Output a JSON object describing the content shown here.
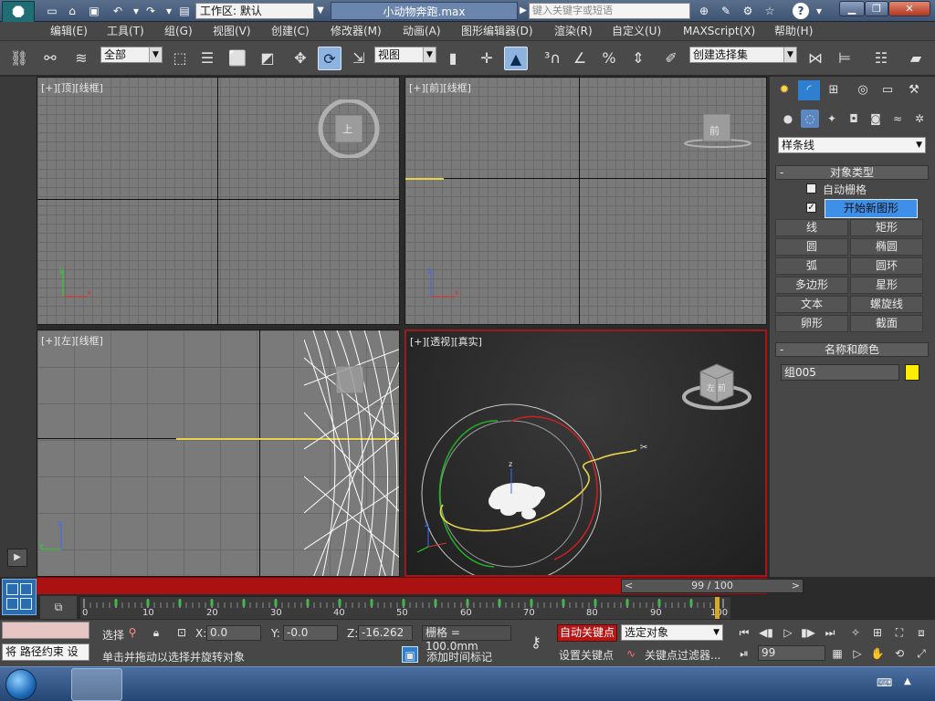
{
  "titlebar": {
    "workspace_label": "工作区: 默认",
    "file_title": "小动物奔跑.max",
    "search_placeholder": "键入关键字或短语"
  },
  "menu": [
    "编辑(E)",
    "工具(T)",
    "组(G)",
    "视图(V)",
    "创建(C)",
    "修改器(M)",
    "动画(A)",
    "图形编辑器(D)",
    "渲染(R)",
    "自定义(U)",
    "MAXScript(X)",
    "帮助(H)"
  ],
  "toolbar": {
    "selection_filter": "全部",
    "reference_coord": "视图",
    "selection_set_placeholder": "创建选择集"
  },
  "viewports": {
    "top": "[+][顶][线框]",
    "front": "[+][前][线框]",
    "left": "[+][左][线框]",
    "perspective": "[+][透视][真实]",
    "cube_top": "上",
    "cube_front": "前",
    "cube_persp": "左  前"
  },
  "command_panel": {
    "category": "样条线",
    "object_type_title": "对象类型",
    "autogrid_label": "自动栅格",
    "start_new_shape_label": "开始新图形",
    "shape_buttons": [
      "线",
      "矩形",
      "圆",
      "椭圆",
      "弧",
      "圆环",
      "多边形",
      "星形",
      "文本",
      "螺旋线",
      "卵形",
      "截面"
    ],
    "name_color_title": "名称和颜色",
    "object_name": "组005",
    "object_color": "#ffee00"
  },
  "timeline": {
    "frame_display": "99 / 100",
    "ticks": [
      "0",
      "10",
      "20",
      "30",
      "40",
      "50",
      "60",
      "70",
      "80",
      "90",
      "100"
    ],
    "current_frame": 99
  },
  "status": {
    "maxscript_output": "将 路径约束 设",
    "selection_label": "选择",
    "x_label": "X:",
    "x_value": "0.0",
    "y_label": "Y:",
    "y_value": "-0.0",
    "z_label": "Z:",
    "z_value": "-16.262",
    "grid_label": "栅格 = 100.0mm",
    "prompt": "单击并拖动以选择并旋转对象",
    "add_time_tag": "添加时间标记",
    "auto_key": "自动关键点",
    "set_key": "设置关键点",
    "key_mode": "选定对象",
    "key_filters": "关键点过滤器...",
    "frame_input": "99"
  }
}
